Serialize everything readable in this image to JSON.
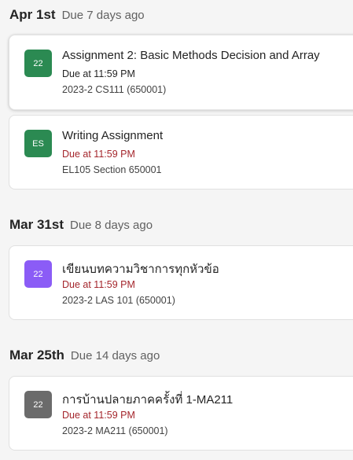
{
  "colors": {
    "badge_green": "#2b8a52",
    "badge_purple": "#8b5cf6",
    "badge_gray": "#6b6b6b",
    "due_dark": "#242424",
    "due_red": "#a4262c"
  },
  "groups": [
    {
      "date": "Apr 1st",
      "due_relative": "Due 7 days ago",
      "assignments": [
        {
          "badge": "22",
          "badge_color": "#2b8a52",
          "title": "Assignment 2: Basic Methods Decision and Array",
          "due": "Due at 11:59 PM",
          "due_color": "#242424",
          "course": "2023-2 CS111 (650001)"
        },
        {
          "badge": "ES",
          "badge_color": "#2b8a52",
          "title": "Writing Assignment",
          "due": "Due at 11:59 PM",
          "due_color": "#a4262c",
          "course": "EL105 Section 650001"
        }
      ]
    },
    {
      "date": "Mar 31st",
      "due_relative": "Due 8 days ago",
      "assignments": [
        {
          "badge": "22",
          "badge_color": "#8b5cf6",
          "title": "เขียนบทความวิชาการทุกหัวข้อ",
          "due": "Due at 11:59 PM",
          "due_color": "#a4262c",
          "course": "2023-2 LAS 101 (650001)"
        }
      ]
    },
    {
      "date": "Mar 25th",
      "due_relative": "Due 14 days ago",
      "assignments": [
        {
          "badge": "22",
          "badge_color": "#6b6b6b",
          "title": "การบ้านปลายภาคครั้งที่ 1-MA211",
          "due": "Due at 11:59 PM",
          "due_color": "#a4262c",
          "course": "2023-2 MA211 (650001)"
        }
      ]
    }
  ]
}
